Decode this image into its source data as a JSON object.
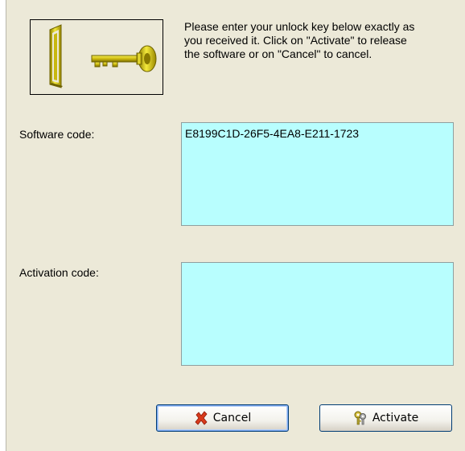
{
  "dialog": {
    "instructions": "Please enter your unlock key below exactly as\nyou received it. Click on \"Activate\" to release\nthe software or on \"Cancel\" to cancel.",
    "logo_icon": "door-and-key-icon"
  },
  "fields": {
    "software_label": "Software code:",
    "software_value": "E8199C1D-26F5-4EA8-E211-1723",
    "activation_label": "Activation code:",
    "activation_value": ""
  },
  "buttons": {
    "cancel_label": "Cancel",
    "cancel_icon": "red-x-icon",
    "activate_label": "Activate",
    "activate_icon": "keys-icon"
  },
  "colors": {
    "field_background": "#b8fefe",
    "panel_background": "#ece9d8",
    "cancel_icon": "#d83a1c",
    "logo_gold": "#c8b400"
  }
}
